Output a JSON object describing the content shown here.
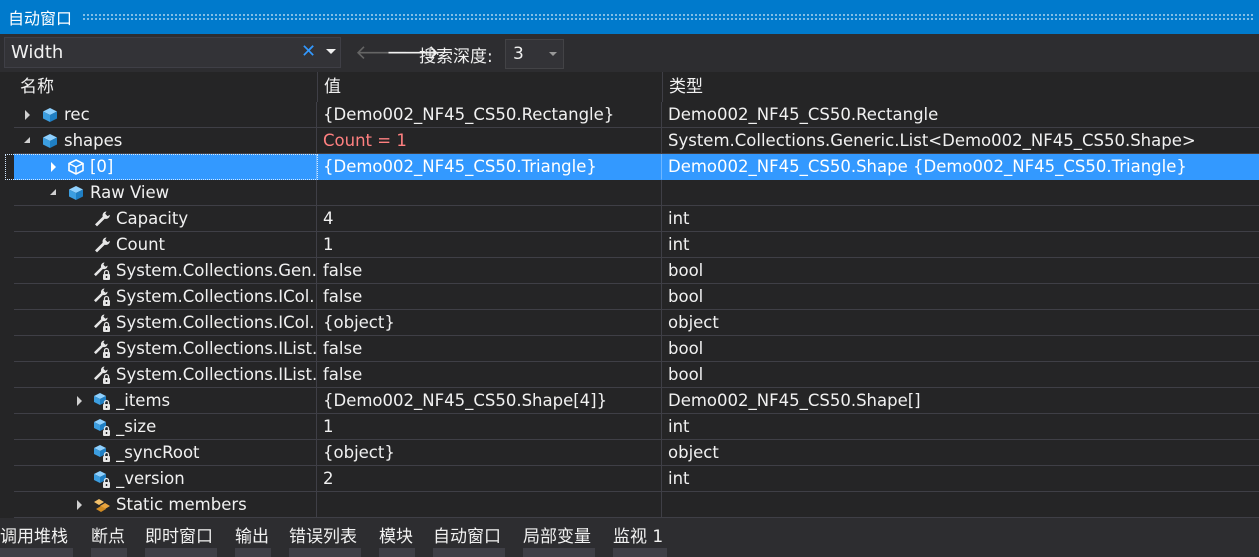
{
  "window": {
    "title": "自动窗口"
  },
  "toolbar": {
    "search_value": "Width",
    "clear_symbol": "✕",
    "back_symbol": "🡐",
    "forward_symbol": "🡒",
    "depth_label": "搜索深度:",
    "depth_value": "3"
  },
  "columns": {
    "name": "名称",
    "value": "值",
    "type": "类型"
  },
  "rows": [
    {
      "name": "rec",
      "value": "{Demo002_NF45_CS50.Rectangle}",
      "type": "Demo002_NF45_CS50.Rectangle",
      "depth": 0,
      "expander": "collapsed",
      "icon": "object-icon",
      "selected": false,
      "changed": false
    },
    {
      "name": "shapes",
      "value": "Count = 1",
      "type": "System.Collections.Generic.List<Demo002_NF45_CS50.Shape>",
      "depth": 0,
      "expander": "expanded",
      "icon": "object-icon",
      "selected": false,
      "changed": true
    },
    {
      "name": "[0]",
      "value": "{Demo002_NF45_CS50.Triangle}",
      "type": "Demo002_NF45_CS50.Shape {Demo002_NF45_CS50.Triangle}",
      "depth": 1,
      "expander": "collapsed",
      "icon": "object-icon",
      "selected": true,
      "changed": false
    },
    {
      "name": "Raw View",
      "value": "",
      "type": "",
      "depth": 1,
      "expander": "expanded",
      "icon": "object-icon",
      "selected": false,
      "changed": false
    },
    {
      "name": "Capacity",
      "value": "4",
      "type": "int",
      "depth": 2,
      "expander": "none",
      "icon": "property-icon",
      "selected": false,
      "changed": false
    },
    {
      "name": "Count",
      "value": "1",
      "type": "int",
      "depth": 2,
      "expander": "none",
      "icon": "property-icon",
      "selected": false,
      "changed": false
    },
    {
      "name": "System.Collections.Gen...",
      "value": "false",
      "type": "bool",
      "depth": 2,
      "expander": "none",
      "icon": "private-property-icon",
      "selected": false,
      "changed": false
    },
    {
      "name": "System.Collections.ICol...",
      "value": "false",
      "type": "bool",
      "depth": 2,
      "expander": "none",
      "icon": "private-property-icon",
      "selected": false,
      "changed": false
    },
    {
      "name": "System.Collections.ICol...",
      "value": "{object}",
      "type": "object",
      "depth": 2,
      "expander": "none",
      "icon": "private-property-icon",
      "selected": false,
      "changed": false
    },
    {
      "name": "System.Collections.IList...",
      "value": "false",
      "type": "bool",
      "depth": 2,
      "expander": "none",
      "icon": "private-property-icon",
      "selected": false,
      "changed": false
    },
    {
      "name": "System.Collections.IList...",
      "value": "false",
      "type": "bool",
      "depth": 2,
      "expander": "none",
      "icon": "private-property-icon",
      "selected": false,
      "changed": false
    },
    {
      "name": "_items",
      "value": "{Demo002_NF45_CS50.Shape[4]}",
      "type": "Demo002_NF45_CS50.Shape[]",
      "depth": 2,
      "expander": "collapsed",
      "icon": "private-field-icon",
      "selected": false,
      "changed": false
    },
    {
      "name": "_size",
      "value": "1",
      "type": "int",
      "depth": 2,
      "expander": "none",
      "icon": "private-field-icon",
      "selected": false,
      "changed": false
    },
    {
      "name": "_syncRoot",
      "value": "{object}",
      "type": "object",
      "depth": 2,
      "expander": "none",
      "icon": "private-field-icon",
      "selected": false,
      "changed": false
    },
    {
      "name": "_version",
      "value": "2",
      "type": "int",
      "depth": 2,
      "expander": "none",
      "icon": "private-field-icon",
      "selected": false,
      "changed": false
    },
    {
      "name": "Static members",
      "value": "",
      "type": "",
      "depth": 2,
      "expander": "collapsed",
      "icon": "static-members-icon",
      "selected": false,
      "changed": false
    }
  ],
  "bottom_tabs": [
    {
      "label": "调用堆栈"
    },
    {
      "label": "断点"
    },
    {
      "label": "即时窗口"
    },
    {
      "label": "输出"
    },
    {
      "label": "错误列表"
    },
    {
      "label": "模块"
    },
    {
      "label": "自动窗口"
    },
    {
      "label": "局部变量"
    },
    {
      "label": "监视 1"
    }
  ],
  "colors": {
    "accent": "#007acc",
    "selection": "#3399ff",
    "background": "#252526",
    "toolbar": "#2d2d30",
    "changed_value": "#ff8080",
    "icon_blue": "#5aaee6",
    "wrench": "#d9d9d9",
    "static_orange": "#e8a33d"
  }
}
